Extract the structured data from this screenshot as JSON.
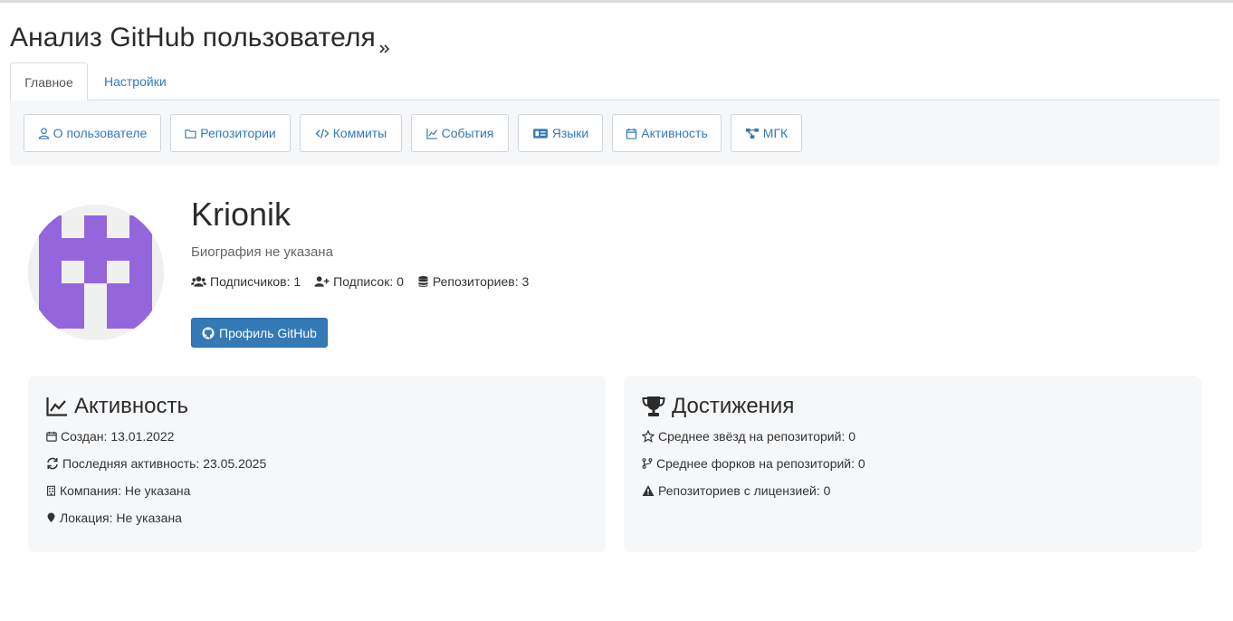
{
  "page": {
    "title": "Анализ GitHub пользователя"
  },
  "tabs": [
    {
      "label": "Главное",
      "active": true
    },
    {
      "label": "Настройки",
      "active": false
    }
  ],
  "toolbar": {
    "buttons": [
      {
        "label": "О пользователе",
        "icon": "user-icon"
      },
      {
        "label": "Репозитории",
        "icon": "folder-icon"
      },
      {
        "label": "Коммиты",
        "icon": "code-icon"
      },
      {
        "label": "События",
        "icon": "chart-line-icon"
      },
      {
        "label": "Языки",
        "icon": "id-card-icon"
      },
      {
        "label": "Активность",
        "icon": "calendar-icon"
      },
      {
        "label": "МГК",
        "icon": "network-icon"
      }
    ]
  },
  "profile": {
    "username": "Krionik",
    "bio": "Биография не указана",
    "stats": {
      "followers": "Подписчиков: 1",
      "following": "Подписок: 0",
      "repos": "Репозиториев: 3"
    },
    "github_button": "Профиль GitHub",
    "avatar_color": "#9466dc"
  },
  "activity": {
    "title": "Активность",
    "created": "Создан: 13.01.2022",
    "last_active": "Последняя активность: 23.05.2025",
    "company": "Компания: Не указана",
    "location": "Локация: Не указана"
  },
  "achievements": {
    "title": "Достижения",
    "avg_stars": "Среднее звёзд на репозиторий: 0",
    "avg_forks": "Среднее форков на репозиторий: 0",
    "licensed": "Репозиториев с лицензией: 0"
  },
  "colors": {
    "accent": "#337ab7",
    "panel": "#f6f7f9"
  }
}
